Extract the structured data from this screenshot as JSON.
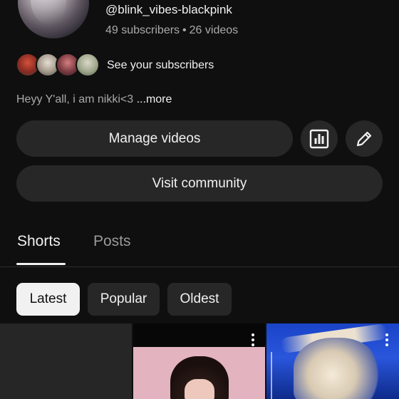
{
  "channel": {
    "handle": "@blink_vibes-blackpink",
    "subscribers": "49 subscribers",
    "separator": "•",
    "videos": "26 videos",
    "see_subscribers": "See your subscribers",
    "bio": "Heyy Y'all, i am nikki<3",
    "bio_more": "...more"
  },
  "actions": {
    "manage_videos": "Manage videos",
    "visit_community": "Visit community",
    "analytics_icon": "analytics-icon",
    "edit_icon": "pencil-icon"
  },
  "tabs": [
    {
      "label": "Shorts",
      "selected": true
    },
    {
      "label": "Posts",
      "selected": false
    }
  ],
  "filters": [
    {
      "label": "Latest",
      "selected": true
    },
    {
      "label": "Popular",
      "selected": false
    },
    {
      "label": "Oldest",
      "selected": false
    }
  ],
  "colors": {
    "background": "#0f0f0f",
    "button": "#272727",
    "text_primary": "#f1f1f1",
    "text_secondary": "#aaaaaa"
  }
}
